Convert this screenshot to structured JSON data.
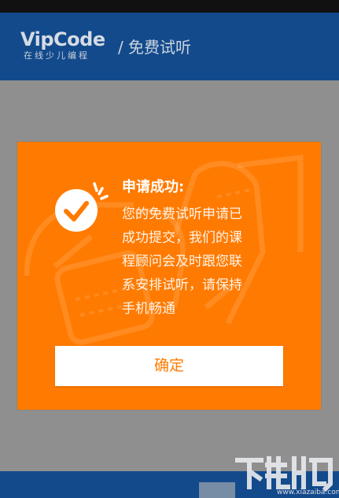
{
  "colors": {
    "header_bg": "#134a8c",
    "overlay_bg": "#8f8f8f",
    "dialog_bg": "#ff7a00",
    "button_bg": "#ffffff",
    "button_text": "#ff7a00"
  },
  "header": {
    "logo_text": "VipCode",
    "logo_subtitle": "在线少儿编程",
    "separator": "/",
    "title": "免费试听"
  },
  "dialog": {
    "icon": "success-check-icon",
    "title": "申请成功:",
    "message_lines": [
      "您的免费试听申请已",
      "成功提交，我们的课",
      "程顾问会及时跟您联",
      "系安排试听，请保持",
      "手机畅通"
    ],
    "confirm_label": "确定"
  },
  "watermark": {
    "site_url": "www.xiazaiba.com"
  }
}
